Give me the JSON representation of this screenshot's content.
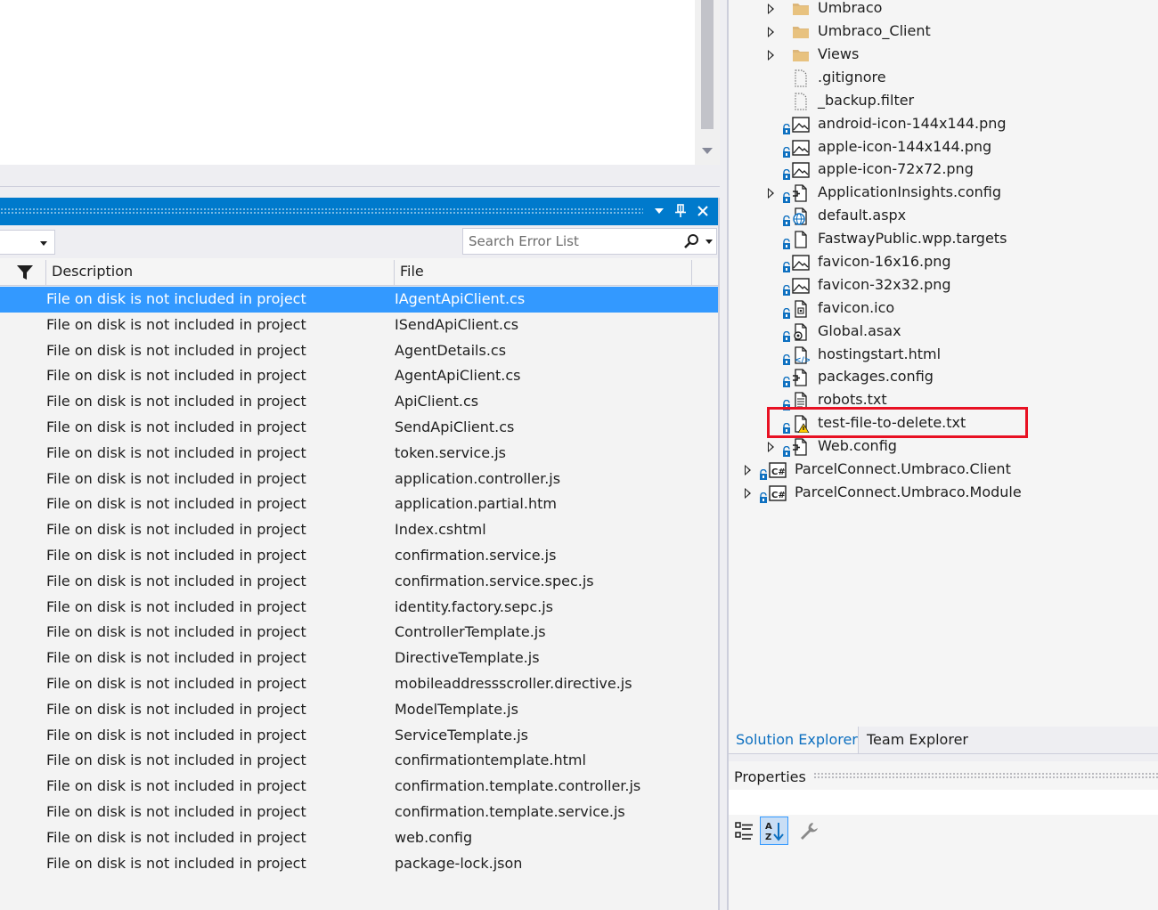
{
  "error_list": {
    "search_placeholder": "Search Error List",
    "columns": {
      "description": "Description",
      "file": "File"
    },
    "rows": [
      {
        "description": "File on disk is not included in project",
        "file": "IAgentApiClient.cs",
        "selected": true
      },
      {
        "description": "File on disk is not included in project",
        "file": "ISendApiClient.cs"
      },
      {
        "description": "File on disk is not included in project",
        "file": "AgentDetails.cs"
      },
      {
        "description": "File on disk is not included in project",
        "file": "AgentApiClient.cs"
      },
      {
        "description": "File on disk is not included in project",
        "file": "ApiClient.cs"
      },
      {
        "description": "File on disk is not included in project",
        "file": "SendApiClient.cs"
      },
      {
        "description": "File on disk is not included in project",
        "file": "token.service.js"
      },
      {
        "description": "File on disk is not included in project",
        "file": "application.controller.js"
      },
      {
        "description": "File on disk is not included in project",
        "file": "application.partial.htm"
      },
      {
        "description": "File on disk is not included in project",
        "file": "Index.cshtml"
      },
      {
        "description": "File on disk is not included in project",
        "file": "confirmation.service.js"
      },
      {
        "description": "File on disk is not included in project",
        "file": "confirmation.service.spec.js"
      },
      {
        "description": "File on disk is not included in project",
        "file": "identity.factory.sepc.js"
      },
      {
        "description": "File on disk is not included in project",
        "file": "ControllerTemplate.js"
      },
      {
        "description": "File on disk is not included in project",
        "file": "DirectiveTemplate.js"
      },
      {
        "description": "File on disk is not included in project",
        "file": "mobileaddressscroller.directive.js"
      },
      {
        "description": "File on disk is not included in project",
        "file": "ModelTemplate.js"
      },
      {
        "description": "File on disk is not included in project",
        "file": "ServiceTemplate.js"
      },
      {
        "description": "File on disk is not included in project",
        "file": "confirmationtemplate.html"
      },
      {
        "description": "File on disk is not included in project",
        "file": "confirmation.template.controller.js"
      },
      {
        "description": "File on disk is not included in project",
        "file": "confirmation.template.service.js"
      },
      {
        "description": "File on disk is not included in project",
        "file": "web.config"
      },
      {
        "description": "File on disk is not included in project",
        "file": "package-lock.json"
      }
    ]
  },
  "solution_explorer": {
    "items": [
      {
        "label": "Umbraco",
        "icon": "folder-icon",
        "expandable": true,
        "locked": false
      },
      {
        "label": "Umbraco_Client",
        "icon": "folder-icon",
        "expandable": true,
        "locked": false
      },
      {
        "label": "Views",
        "icon": "folder-icon",
        "expandable": true,
        "locked": false
      },
      {
        "label": ".gitignore",
        "icon": "excluded-file-icon",
        "expandable": false,
        "locked": false
      },
      {
        "label": "_backup.filter",
        "icon": "excluded-file-icon",
        "expandable": false,
        "locked": false
      },
      {
        "label": "android-icon-144x144.png",
        "icon": "image-file-icon",
        "expandable": false,
        "locked": true
      },
      {
        "label": "apple-icon-144x144.png",
        "icon": "image-file-icon",
        "expandable": false,
        "locked": true
      },
      {
        "label": "apple-icon-72x72.png",
        "icon": "image-file-icon",
        "expandable": false,
        "locked": true
      },
      {
        "label": "ApplicationInsights.config",
        "icon": "config-file-icon",
        "expandable": true,
        "locked": true
      },
      {
        "label": "default.aspx",
        "icon": "web-page-icon",
        "expandable": false,
        "locked": true
      },
      {
        "label": "FastwayPublic.wpp.targets",
        "icon": "file-icon",
        "expandable": false,
        "locked": true
      },
      {
        "label": "favicon-16x16.png",
        "icon": "image-file-icon",
        "expandable": false,
        "locked": true
      },
      {
        "label": "favicon-32x32.png",
        "icon": "image-file-icon",
        "expandable": false,
        "locked": true
      },
      {
        "label": "favicon.ico",
        "icon": "ico-file-icon",
        "expandable": false,
        "locked": true
      },
      {
        "label": "Global.asax",
        "icon": "asax-file-icon",
        "expandable": false,
        "locked": true
      },
      {
        "label": "hostingstart.html",
        "icon": "html-file-icon",
        "expandable": false,
        "locked": true
      },
      {
        "label": "packages.config",
        "icon": "config-file-icon",
        "expandable": false,
        "locked": true
      },
      {
        "label": "robots.txt",
        "icon": "text-file-icon",
        "expandable": false,
        "locked": true
      },
      {
        "label": "test-file-to-delete.txt",
        "icon": "missing-file-warning-icon",
        "expandable": false,
        "locked": true
      },
      {
        "label": "Web.config",
        "icon": "config-file-icon",
        "expandable": true,
        "locked": true
      },
      {
        "label": "ParcelConnect.Umbraco.Client",
        "icon": "csharp-project-icon",
        "expandable": true,
        "locked": true
      },
      {
        "label": "ParcelConnect.Umbraco.Module",
        "icon": "csharp-project-icon",
        "expandable": true,
        "locked": true
      }
    ],
    "tabs": [
      "Solution Explorer",
      "Team Explorer"
    ]
  },
  "properties": {
    "title": "Properties"
  },
  "colors": {
    "accent": "#007acc",
    "selection": "#3399ff",
    "highlight_box": "#e81123",
    "warning": "#ffcc00",
    "folder": "#dcb67a"
  }
}
